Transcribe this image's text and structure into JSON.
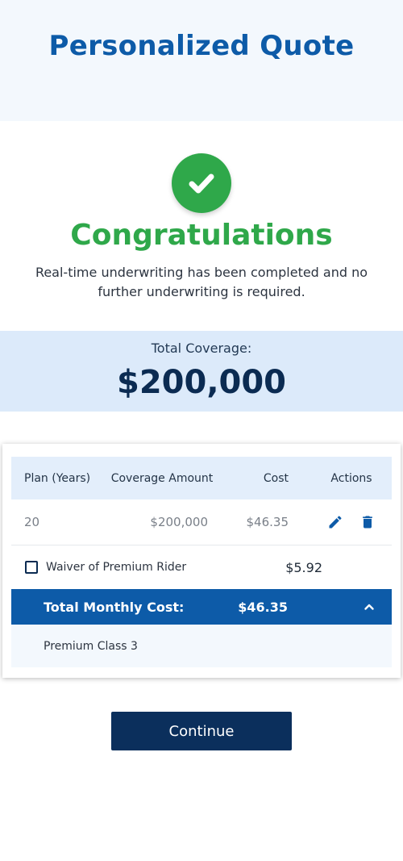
{
  "page": {
    "title": "Personalized Quote"
  },
  "status": {
    "icon": "check-circle-icon",
    "heading": "Congratulations",
    "message": "Real-time underwriting has been completed and no further underwriting is required."
  },
  "coverage": {
    "label": "Total Coverage:",
    "amount": "$200,000"
  },
  "quote_table": {
    "headers": [
      "Plan (Years)",
      "Coverage Amount",
      "Cost",
      "Actions"
    ],
    "rows": [
      {
        "plan_years": "20",
        "coverage_amount": "$200,000",
        "cost": "$46.35",
        "actions": [
          "edit-icon",
          "trash-icon"
        ]
      }
    ],
    "rider": {
      "label": "Waiver of Premium Rider",
      "cost": "$5.92",
      "checked": false
    },
    "total": {
      "label": "Total Monthly Cost:",
      "cost": "$46.35",
      "expanded": true
    },
    "premium_class": "Premium Class 3"
  },
  "actions": {
    "continue_label": "Continue"
  },
  "colors": {
    "brand_blue": "#0d5ba8",
    "navy": "#0b2f5c",
    "success_green": "#2fa84a",
    "light_bg": "#f3f8fd",
    "coverage_bg": "#dceafa"
  }
}
